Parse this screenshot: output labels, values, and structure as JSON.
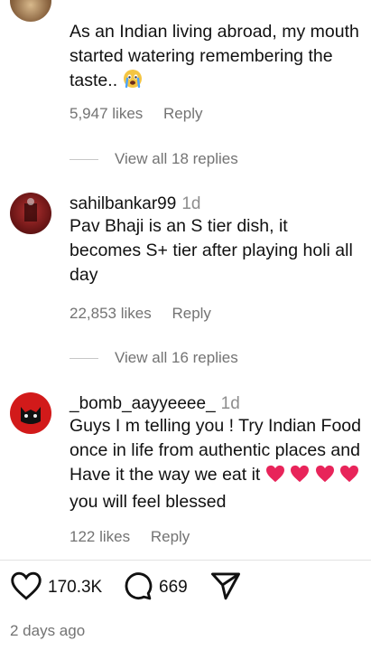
{
  "comments": [
    {
      "username": "",
      "age": "",
      "text": "As an Indian living abroad, my mouth started watering remembering the taste..",
      "likes": "5,947 likes",
      "reply": "Reply",
      "view_replies": "View all 18 replies"
    },
    {
      "username": "sahilbankar99",
      "age": "1d",
      "text": "Pav Bhaji is an S tier dish, it becomes S+ tier after playing holi all day",
      "likes": "22,853 likes",
      "reply": "Reply",
      "view_replies": "View all 16 replies"
    },
    {
      "username": "_bomb_aayyeeee_",
      "age": "1d",
      "text_part1": "Guys I m telling you ! Try Indian Food once in life from authentic places and Have it the way we eat it",
      "text_part2": "you will feel blessed",
      "likes": "122 likes",
      "reply": "Reply"
    }
  ],
  "post": {
    "like_count": "170.3K",
    "comment_count": "669",
    "posted": "2 days ago"
  },
  "colors": {
    "text": "#111111",
    "muted": "#737373",
    "heart_emoji": "#e8245a"
  },
  "icons": [
    "heart-icon",
    "comment-icon",
    "share-icon",
    "crying-emoji",
    "heart-emoji"
  ]
}
